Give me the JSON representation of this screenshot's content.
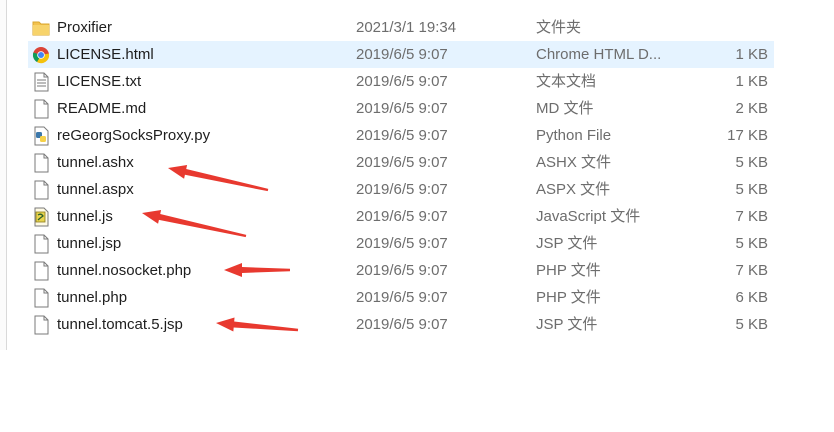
{
  "files": [
    {
      "name": "Proxifier",
      "date": "2021/3/1 19:34",
      "type": "文件夹",
      "size": "",
      "icon": "folder-icon"
    },
    {
      "name": "LICENSE.html",
      "date": "2019/6/5 9:07",
      "type": "Chrome HTML D...",
      "size": "1 KB",
      "icon": "chrome-icon"
    },
    {
      "name": "LICENSE.txt",
      "date": "2019/6/5 9:07",
      "type": "文本文档",
      "size": "1 KB",
      "icon": "text-document-icon"
    },
    {
      "name": "README.md",
      "date": "2019/6/5 9:07",
      "type": "MD 文件",
      "size": "2 KB",
      "icon": "file-icon"
    },
    {
      "name": "reGeorgSocksProxy.py",
      "date": "2019/6/5 9:07",
      "type": "Python File",
      "size": "17 KB",
      "icon": "python-icon"
    },
    {
      "name": "tunnel.ashx",
      "date": "2019/6/5 9:07",
      "type": "ASHX 文件",
      "size": "5 KB",
      "icon": "file-icon"
    },
    {
      "name": "tunnel.aspx",
      "date": "2019/6/5 9:07",
      "type": "ASPX 文件",
      "size": "5 KB",
      "icon": "file-icon"
    },
    {
      "name": "tunnel.js",
      "date": "2019/6/5 9:07",
      "type": "JavaScript 文件",
      "size": "7 KB",
      "icon": "javascript-icon"
    },
    {
      "name": "tunnel.jsp",
      "date": "2019/6/5 9:07",
      "type": "JSP 文件",
      "size": "5 KB",
      "icon": "file-icon"
    },
    {
      "name": "tunnel.nosocket.php",
      "date": "2019/6/5 9:07",
      "type": "PHP 文件",
      "size": "7 KB",
      "icon": "file-icon"
    },
    {
      "name": "tunnel.php",
      "date": "2019/6/5 9:07",
      "type": "PHP 文件",
      "size": "6 KB",
      "icon": "file-icon"
    },
    {
      "name": "tunnel.tomcat.5.jsp",
      "date": "2019/6/5 9:07",
      "type": "JSP 文件",
      "size": "5 KB",
      "icon": "file-icon"
    }
  ],
  "annotations": {
    "arrow_color": "#e8392f"
  }
}
